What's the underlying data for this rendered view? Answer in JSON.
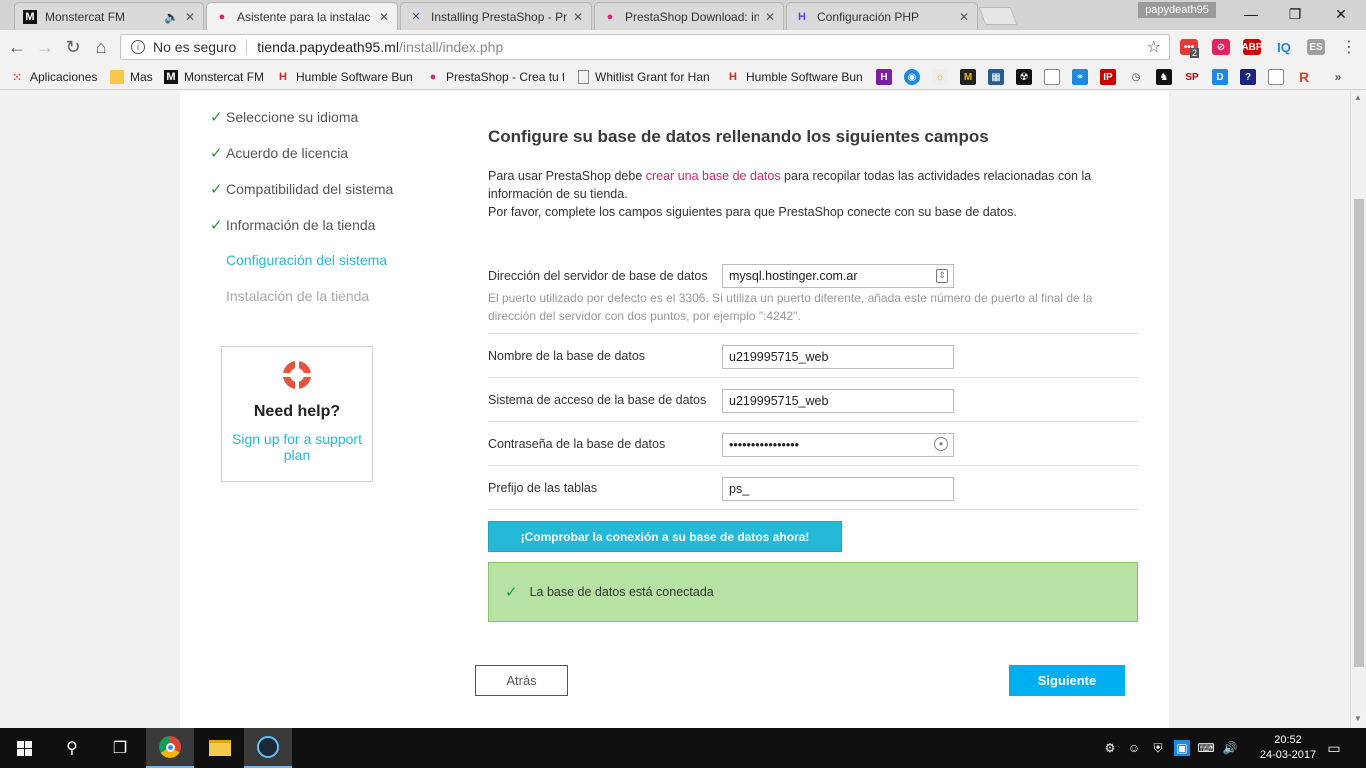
{
  "browser": {
    "tabs": [
      {
        "label": "Monstercat FM",
        "icon": "monstercat-icon"
      },
      {
        "label": "Asistente para la instalac",
        "icon": "prestashop-icon"
      },
      {
        "label": "Installing PrestaShop - Pr",
        "icon": "confluence-icon"
      },
      {
        "label": "PrestaShop Download: in",
        "icon": "prestashop-icon"
      },
      {
        "label": "Configuración PHP",
        "icon": "hostinger-icon"
      }
    ],
    "profile": "papydeath95",
    "security": "No es seguro",
    "url_host": "tienda.papydeath95.ml",
    "url_path": "/install/index.php",
    "ext_badge": "2"
  },
  "bookmarks": [
    {
      "label": "Aplicaciones",
      "icon": "apps-icon"
    },
    {
      "label": "Mas",
      "icon": "folder-icon"
    },
    {
      "label": "Monstercat FM",
      "icon": "monstercat-icon"
    },
    {
      "label": "Humble Software Bun",
      "icon": "humble-icon"
    },
    {
      "label": "PrestaShop - Crea tu t",
      "icon": "prestashop-icon"
    },
    {
      "label": "Whitlist Grant for Han",
      "icon": "page-icon"
    },
    {
      "label": "Humble Software Bun",
      "icon": "humble-icon"
    }
  ],
  "steps": [
    {
      "label": "Seleccione su idioma",
      "done": true
    },
    {
      "label": "Acuerdo de licencia",
      "done": true
    },
    {
      "label": "Compatibilidad del sistema",
      "done": true
    },
    {
      "label": "Información de la tienda",
      "done": true
    },
    {
      "label": "Configuración del sistema",
      "done": false,
      "current": true
    },
    {
      "label": "Instalación de la tienda",
      "done": false
    }
  ],
  "help": {
    "title": "Need help?",
    "link": "Sign up for a support plan"
  },
  "main": {
    "title": "Configure su base de datos rellenando los siguientes campos",
    "intro_before": "Para usar PrestaShop debe ",
    "intro_link": "crear una base de datos",
    "intro_after": " para recopilar todas las actividades relacionadas con la información de su tienda.",
    "intro_line2": "Por favor, complete los campos siguientes para que PrestaShop conecte con su base de datos."
  },
  "fields": {
    "server": {
      "label": "Dirección del servidor de base de datos",
      "value": "mysql.hostinger.com.ar",
      "help": "El puerto utilizado por defecto es el 3306. Si utiliza un puerto diferente, añada este número de puerto al final de la dirección del servidor con dos puntos, por ejemplo \":4242\"."
    },
    "dbname": {
      "label": "Nombre de la base de datos",
      "value": "u219995715_web"
    },
    "login": {
      "label": "Sistema de acceso de la base de datos",
      "value": "u219995715_web"
    },
    "password": {
      "label": "Contraseña de la base de datos",
      "value": "••••••••••••••••"
    },
    "prefix": {
      "label": "Prefijo de las tablas",
      "value": "ps_"
    }
  },
  "check_button": "¡Comprobar la conexión a su base de datos ahora!",
  "success_message": "La base de datos está conectada",
  "nav": {
    "back": "Atrás",
    "next": "Siguiente"
  },
  "taskbar": {
    "time": "20:52",
    "date": "24-03-2017"
  },
  "colors": {
    "accent": "#25b9d7",
    "next": "#00aff0",
    "success_bg": "#b6e2a4",
    "check": "#1e9e3a",
    "link": "#d0277a"
  }
}
